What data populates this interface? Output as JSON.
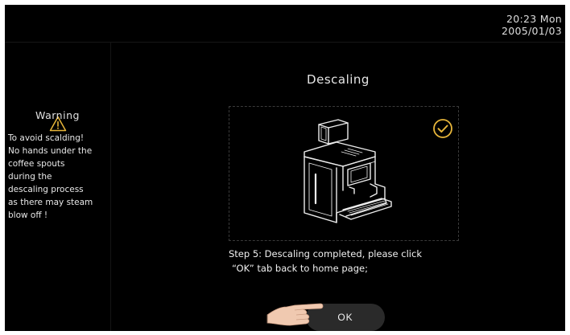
{
  "clock": {
    "time": "20:23  Mon",
    "date": "2005/01/03"
  },
  "sidebar": {
    "icon": "warning-triangle-icon",
    "title": "Warning",
    "text": "To avoid scalding!\nNo hands under the\ncoffee spouts\nduring the\ndescaling process\nas there may steam\nblow off !"
  },
  "main": {
    "title": "Descaling",
    "illustration_icon": "coffee-machine-illustration",
    "status_icon": "check-circle-icon",
    "step_line1": "Step 5: Descaling completed, please click",
    "step_line2": "“OK”  tab back to home page;",
    "ok_label": "OK",
    "pointer_icon": "pointing-hand-icon"
  },
  "colors": {
    "background": "#000000",
    "accent": "#e8b63a",
    "text": "#e6e6e6",
    "button": "#2a2a2a"
  }
}
